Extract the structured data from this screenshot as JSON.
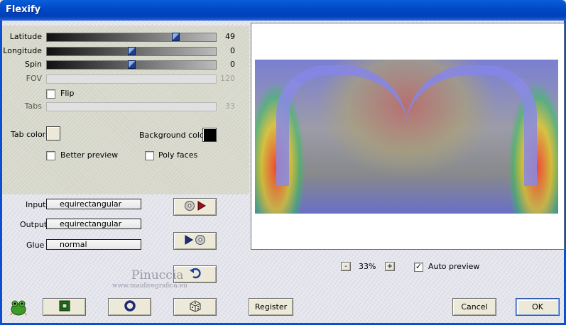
{
  "window": {
    "title": "Flexify"
  },
  "sliders": {
    "latitude": {
      "label": "Latitude",
      "value": "49",
      "fraction": 0.75
    },
    "longitude": {
      "label": "Longitude",
      "value": "0",
      "fraction": 0.5
    },
    "spin": {
      "label": "Spin",
      "value": "0",
      "fraction": 0.5
    },
    "fov": {
      "label": "FOV",
      "value": "120"
    },
    "tabs": {
      "label": "Tabs",
      "value": "33"
    }
  },
  "options": {
    "flip": {
      "label": "Flip",
      "checked": false
    },
    "tab_color": {
      "label": "Tab color",
      "color": "#ece9d8"
    },
    "background_color": {
      "label": "Background color",
      "color": "#000000"
    },
    "better_preview": {
      "label": "Better preview",
      "checked": false
    },
    "poly_faces": {
      "label": "Poly faces",
      "checked": false
    }
  },
  "projection": {
    "input": {
      "label": "Input",
      "value": "equirectangular"
    },
    "output": {
      "label": "Output",
      "value": "equirectangular"
    },
    "glue": {
      "label": "Glue",
      "value": "normal"
    }
  },
  "watermark": {
    "name": "Pinuccia",
    "site": "www.maidiregrafica.eu"
  },
  "zoom": {
    "minus": "-",
    "value": "33%",
    "plus": "+"
  },
  "auto_preview": {
    "label": "Auto preview",
    "checked": true,
    "mark": "✓"
  },
  "buttons": {
    "register": "Register",
    "cancel": "Cancel",
    "ok": "OK"
  },
  "icons": {
    "transfer_in": "cd-to-arrow-icon",
    "transfer_out": "arrow-to-cd-icon",
    "undo": "undo-arrow-icon",
    "plugin_logo": "frog-logo-icon",
    "frame": "green-square-icon",
    "torus": "ring-icon",
    "random": "dice-icon"
  }
}
